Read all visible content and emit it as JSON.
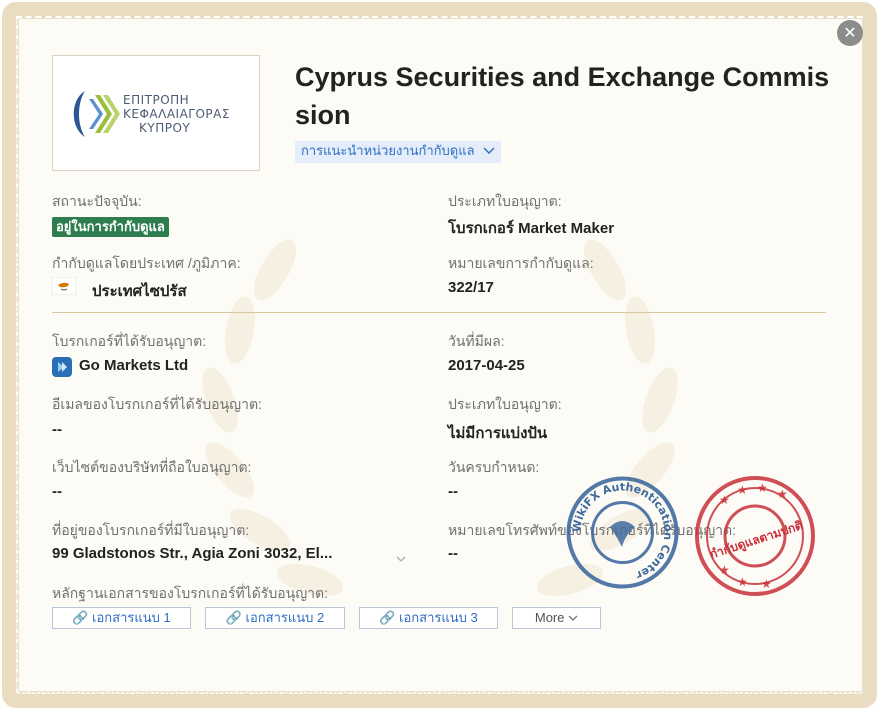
{
  "header": {
    "logo_lines": [
      "ΕΠΙΤΡΟΠΗ",
      "ΚΕΦΑΛΑΙΑΓΟΡΑΣ",
      "ΚΥΠΡΟΥ"
    ],
    "title": "Cyprus Securities and Exchange Commission",
    "regulator_recommendation": "การแนะนำหน่วยงานกำกับดูแล"
  },
  "fields": {
    "current_status": {
      "label": "สถานะปัจจุบัน:",
      "value": "อยู่ในการกำกับดูแล"
    },
    "license_type": {
      "label": "ประเภทใบอนุญาต:",
      "value": "โบรกเกอร์ Market Maker"
    },
    "regulated_by": {
      "label": "กำกับดูแลโดยประเทศ /ภูมิภาค:",
      "value": "ประเทศไซปรัส"
    },
    "regulatory_number": {
      "label": "หมายเลขการกำกับดูแล:",
      "value": "322/17"
    },
    "licensed_broker": {
      "label": "โบรกเกอร์ที่ได้รับอนุญาต:",
      "value": "Go Markets Ltd"
    },
    "effective_date": {
      "label": "วันที่มีผล:",
      "value": "2017-04-25"
    },
    "broker_email": {
      "label": "อีเมลของโบรกเกอร์ที่ได้รับอนุญาต:",
      "value": "--"
    },
    "license_type_2": {
      "label": "ประเภทใบอนุญาต:",
      "value": "ไม่มีการแบ่งปัน"
    },
    "website": {
      "label": "เว็บไซต์ของบริษัทที่ถือใบอนุญาต:",
      "value": "--"
    },
    "expiry_date": {
      "label": "วันครบกำหนด:",
      "value": "--"
    },
    "address": {
      "label": "ที่อยู่ของโบรกเกอร์ที่มีใบอนุญาต:",
      "value": "99 Gladstonos Str., Agia Zoni 3032, El..."
    },
    "phone": {
      "label": "หมายเลขโทรศัพท์ของโบรกเกอร์ที่ได้รับอนุญาต:",
      "value": "--"
    },
    "documents": {
      "label": "หลักฐานเอกสารของโบรกเกอร์ที่ได้รับอนุญาต:"
    }
  },
  "documents": [
    "เอกสารแนบ 1",
    "เอกสารแนบ 2",
    "เอกสารแนบ 3"
  ],
  "more_label": "More",
  "stamps": {
    "blue_text": "WikiFX Authentication Center",
    "red_text": "กำกับดูแลตามปกติ"
  },
  "colors": {
    "status_green": "#2e7d4f",
    "link_blue": "#2f6fc4",
    "stamp_red": "#c8303a",
    "stamp_blue": "#3f6a9e"
  },
  "icons": [
    "close-icon",
    "cyprus-flag-icon",
    "broker-logo-icon",
    "chevron-down-icon",
    "link-icon"
  ]
}
